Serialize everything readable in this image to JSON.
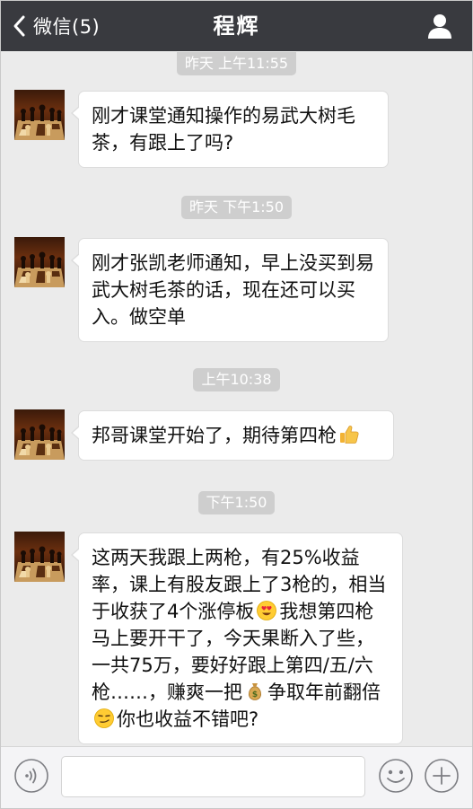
{
  "header": {
    "back_label": "微信(5)",
    "title": "程辉",
    "background": "#393a3f"
  },
  "icons": {
    "back": "chevron-left-icon",
    "profile": "user-icon",
    "voice": "voice-icon",
    "emoji": "emoji-icon",
    "plus": "plus-icon"
  },
  "messages": [
    {
      "timestamp": "昨天 上午11:55",
      "text": "刚才课堂通知操作的易武大树毛茶，有跟上了吗?"
    },
    {
      "timestamp": "昨天 下午1:50",
      "text": "刚才张凯老师通知，早上没买到易武大树毛茶的话，现在还可以买入。做空单"
    },
    {
      "timestamp": "上午10:38",
      "text": "邦哥课堂开始了，期待第四枪",
      "emoji": "thumbs-up-icon"
    },
    {
      "timestamp": "下午1:50",
      "segments": [
        "这两天我跟上两枪，有25%收益率，课上有股友跟上了3枪的，相当于收获了4个涨停板",
        "我想第四枪马上要开干了，今天果断入了些，一共75万，要好好跟上第四/五/六枪……，赚爽一把",
        "争取年前翻倍",
        "你也收益不错吧?"
      ],
      "emojis": [
        "heart-eyes-emoji-icon",
        "money-bag-emoji-icon",
        "smirk-emoji-icon"
      ]
    }
  ],
  "input": {
    "value": "",
    "placeholder": ""
  }
}
